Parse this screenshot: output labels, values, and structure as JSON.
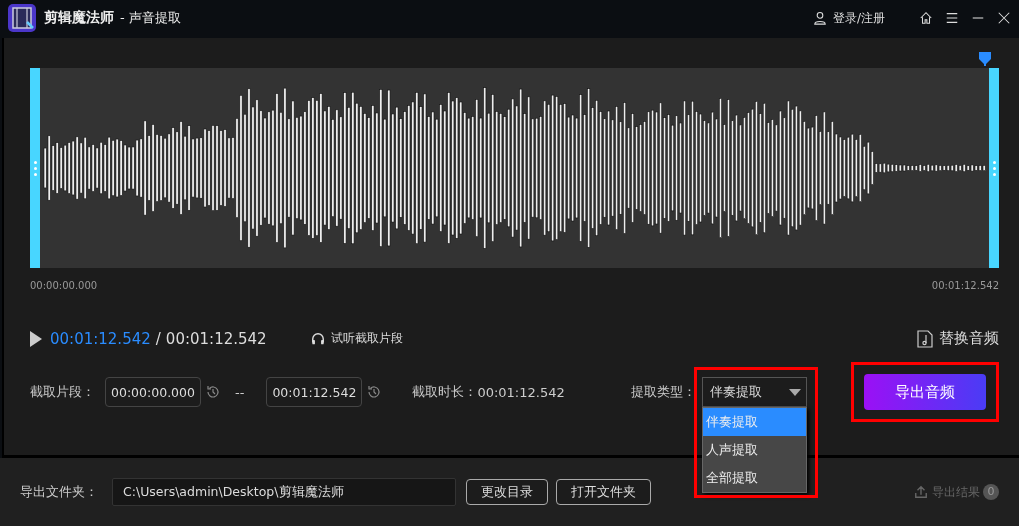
{
  "window": {
    "app_name": "剪辑魔法师",
    "title": "- 声音提取",
    "login": "登录/注册"
  },
  "timeline": {
    "start": "00:00:00.000",
    "end": "00:01:12.542"
  },
  "player": {
    "current": "00:01:12.542",
    "separator": "/",
    "total": "00:01:12.542",
    "preview_label": "试听截取片段",
    "replace_label": "替换音频"
  },
  "clip": {
    "label": "截取片段：",
    "start": "00:00:00.000",
    "separator": "--",
    "end": "00:01:12.542",
    "duration_label": "截取时长：",
    "duration": "00:01:12.542"
  },
  "extract": {
    "label": "提取类型：",
    "value": "伴奏提取",
    "expanded": true,
    "options": [
      {
        "label": "伴奏提取",
        "selected": true
      },
      {
        "label": "人声提取",
        "selected": false
      },
      {
        "label": "全部提取",
        "selected": false
      }
    ]
  },
  "export_button": "导出音频",
  "output": {
    "label": "导出文件夹：",
    "path": "C:\\Users\\admin\\Desktop\\剪辑魔法师",
    "change_button": "更改目录",
    "open_button": "打开文件夹",
    "results_label": "导出结果",
    "results_count": "0"
  }
}
